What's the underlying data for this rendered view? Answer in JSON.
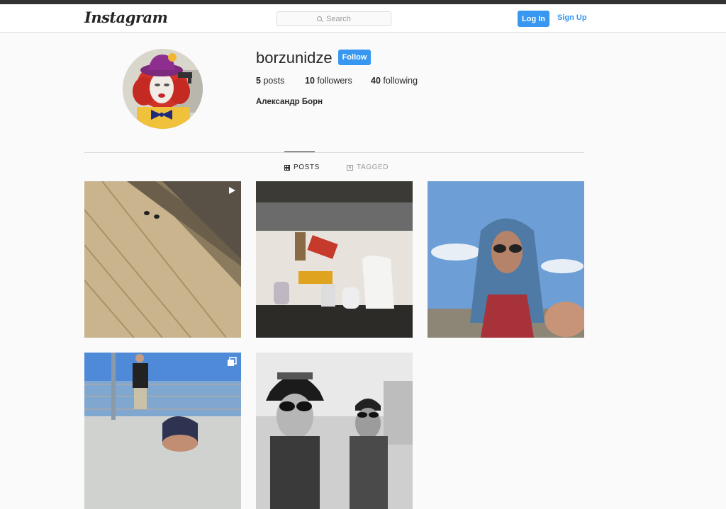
{
  "nav": {
    "logo": "Instagram",
    "search_placeholder": "Search",
    "login_label": "Log In",
    "signup_label": "Sign Up"
  },
  "profile": {
    "username": "borzunidze",
    "follow_label": "Follow",
    "posts_count": "5",
    "posts_label": "posts",
    "followers_count": "10",
    "followers_label": "followers",
    "following_count": "40",
    "following_label": "following",
    "full_name": "Александр Борн"
  },
  "tabs": [
    {
      "label": "POSTS",
      "icon": "grid-icon",
      "active": true
    },
    {
      "label": "TAGGED",
      "icon": "tag-icon",
      "active": false
    }
  ],
  "posts": [
    {
      "type": "video",
      "icon": "video-icon"
    },
    {
      "type": "photo"
    },
    {
      "type": "photo"
    },
    {
      "type": "carousel",
      "icon": "carousel-icon"
    },
    {
      "type": "photo"
    }
  ],
  "colors": {
    "accent": "#3897f0",
    "text": "#262626",
    "muted": "#999999",
    "border": "#dbdbdb",
    "background": "#fafafa"
  }
}
